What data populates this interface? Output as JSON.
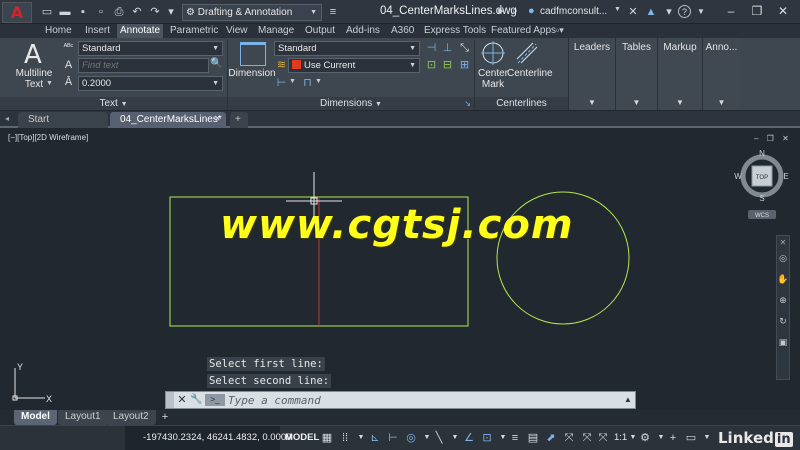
{
  "titlebar": {
    "logo_letter": "A",
    "workspace": "Drafting & Annotation",
    "document_title": "04_CenterMarksLines.dwg",
    "user": "cadfmconsult..."
  },
  "ribbon_tabs": [
    "Home",
    "Insert",
    "Annotate",
    "Parametric",
    "View",
    "Manage",
    "Output",
    "Add-ins",
    "A360",
    "Express Tools",
    "Featured Apps"
  ],
  "active_ribbon_tab": "Annotate",
  "text_panel": {
    "big_button_line1": "Multiline",
    "big_button_line2": "Text",
    "style_value": "Standard",
    "find_placeholder": "Find text",
    "height_value": "0.2000",
    "title": "Text"
  },
  "dimensions_panel": {
    "big_button": "Dimension",
    "style_value": "Standard",
    "layer_value": "Use Current",
    "layer_color": "#e03a1a",
    "title": "Dimensions"
  },
  "centerlines_panel": {
    "center_mark_line1": "Center",
    "center_mark_line2": "Mark",
    "centerline": "Centerline",
    "title": "Centerlines"
  },
  "collapsed_panels": [
    "Leaders",
    "Tables",
    "Markup",
    "Anno..."
  ],
  "file_tabs": {
    "start": "Start",
    "active": "04_CenterMarksLines*",
    "add": "+"
  },
  "viewport": {
    "label": "[−][Top][2D Wireframe]",
    "viewcube": {
      "top_face": "TOP",
      "n": "N",
      "s": "S",
      "e": "E",
      "w": "W",
      "wcs": "WCS"
    },
    "ucs": {
      "x": "X",
      "y": "Y"
    },
    "geometry_color": "#b3e84f",
    "centerline_color": "#c0392b"
  },
  "watermark": "www.cgtsj.com",
  "command": {
    "history": [
      "Select first line:",
      "Select second line:"
    ],
    "placeholder": "Type a command",
    "prompt_icon": ">_"
  },
  "layout_tabs": [
    "Model",
    "Layout1",
    "Layout2"
  ],
  "active_layout_tab": "Model",
  "status": {
    "coordinates": "-197430.2324, 46241.4832, 0.0000",
    "space": "MODEL",
    "annotation_scale": "1:1"
  },
  "brand": {
    "name": "Linked",
    "suffix": "in"
  }
}
